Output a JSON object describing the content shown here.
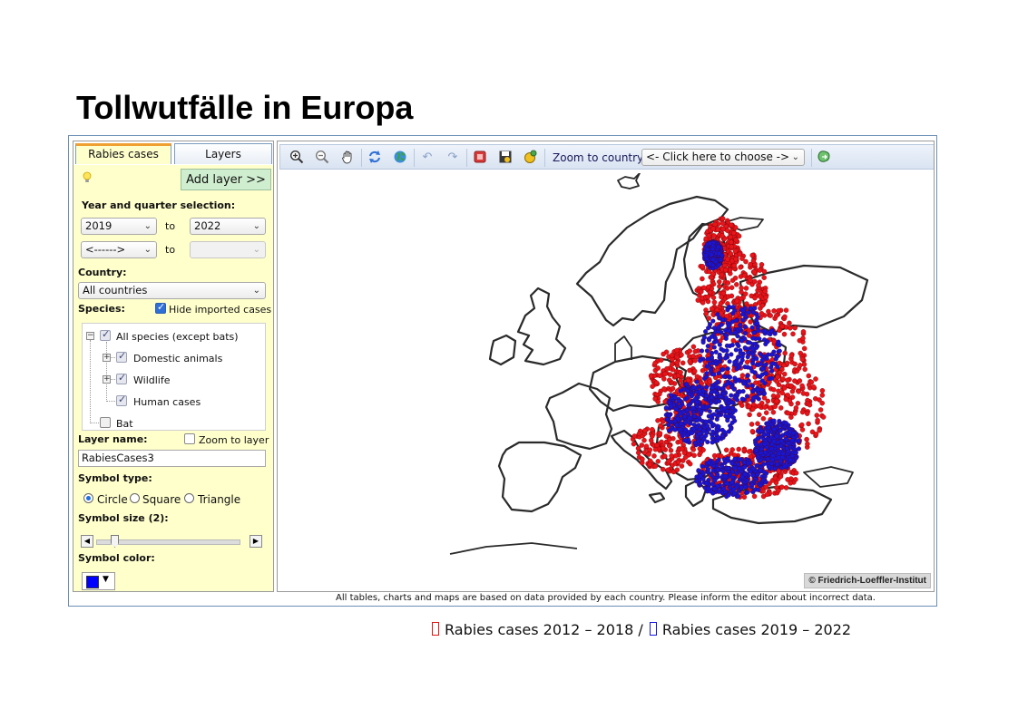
{
  "slide_title": "Tollwutfälle in Europa",
  "tabs": {
    "rabies_cases": "Rabies cases",
    "layers": "Layers"
  },
  "add_layer": "Add layer >>",
  "year_section": {
    "label": "Year and quarter selection:",
    "year_from": "2019",
    "year_to": "2022",
    "quarter_from": "<------>",
    "to_label": "to",
    "quarter_to": ""
  },
  "country": {
    "label": "Country:",
    "value": "All countries"
  },
  "species": {
    "label": "Species:",
    "hide_imported": "Hide imported cases",
    "all_species": "All species (except bats)",
    "domestic": "Domestic animals",
    "wildlife": "Wildlife",
    "human": "Human cases",
    "bat": "Bat"
  },
  "layer": {
    "label": "Layer name:",
    "zoom_to_layer": "Zoom to layer",
    "value": "RabiesCases3"
  },
  "symbol_type": {
    "label": "Symbol type:",
    "circle": "Circle",
    "square": "Square",
    "triangle": "Triangle"
  },
  "symbol_size": {
    "label": "Symbol size (2):",
    "value": 2
  },
  "symbol_color": {
    "label": "Symbol color:",
    "value": "#0000ff"
  },
  "toolbar": {
    "zoom_to_country_label": "Zoom to country:",
    "zoom_to_country_value": "<- Click here to choose ->",
    "icons": [
      "zoom-in-icon",
      "zoom-out-icon",
      "pan-hand-icon",
      "refresh-icon",
      "globe-icon",
      "undo-icon",
      "redo-icon",
      "stop-icon",
      "save-icon",
      "identify-icon",
      "export-icon"
    ]
  },
  "credit": "© Friedrich-Loeffler-Institut",
  "footer_note": "All tables, charts and maps are based on data provided by each country. Please inform the editor about incorrect data.",
  "legend": {
    "red_label": "Rabies cases 2012 – 2018 /",
    "blue_label": "Rabies cases 2019 – 2022",
    "red_color": "#e01515",
    "blue_color": "#1515e0"
  },
  "colors": {
    "panel_bg": "#ffffcc",
    "case_red": "#e8141a",
    "case_blue": "#1616d8"
  }
}
